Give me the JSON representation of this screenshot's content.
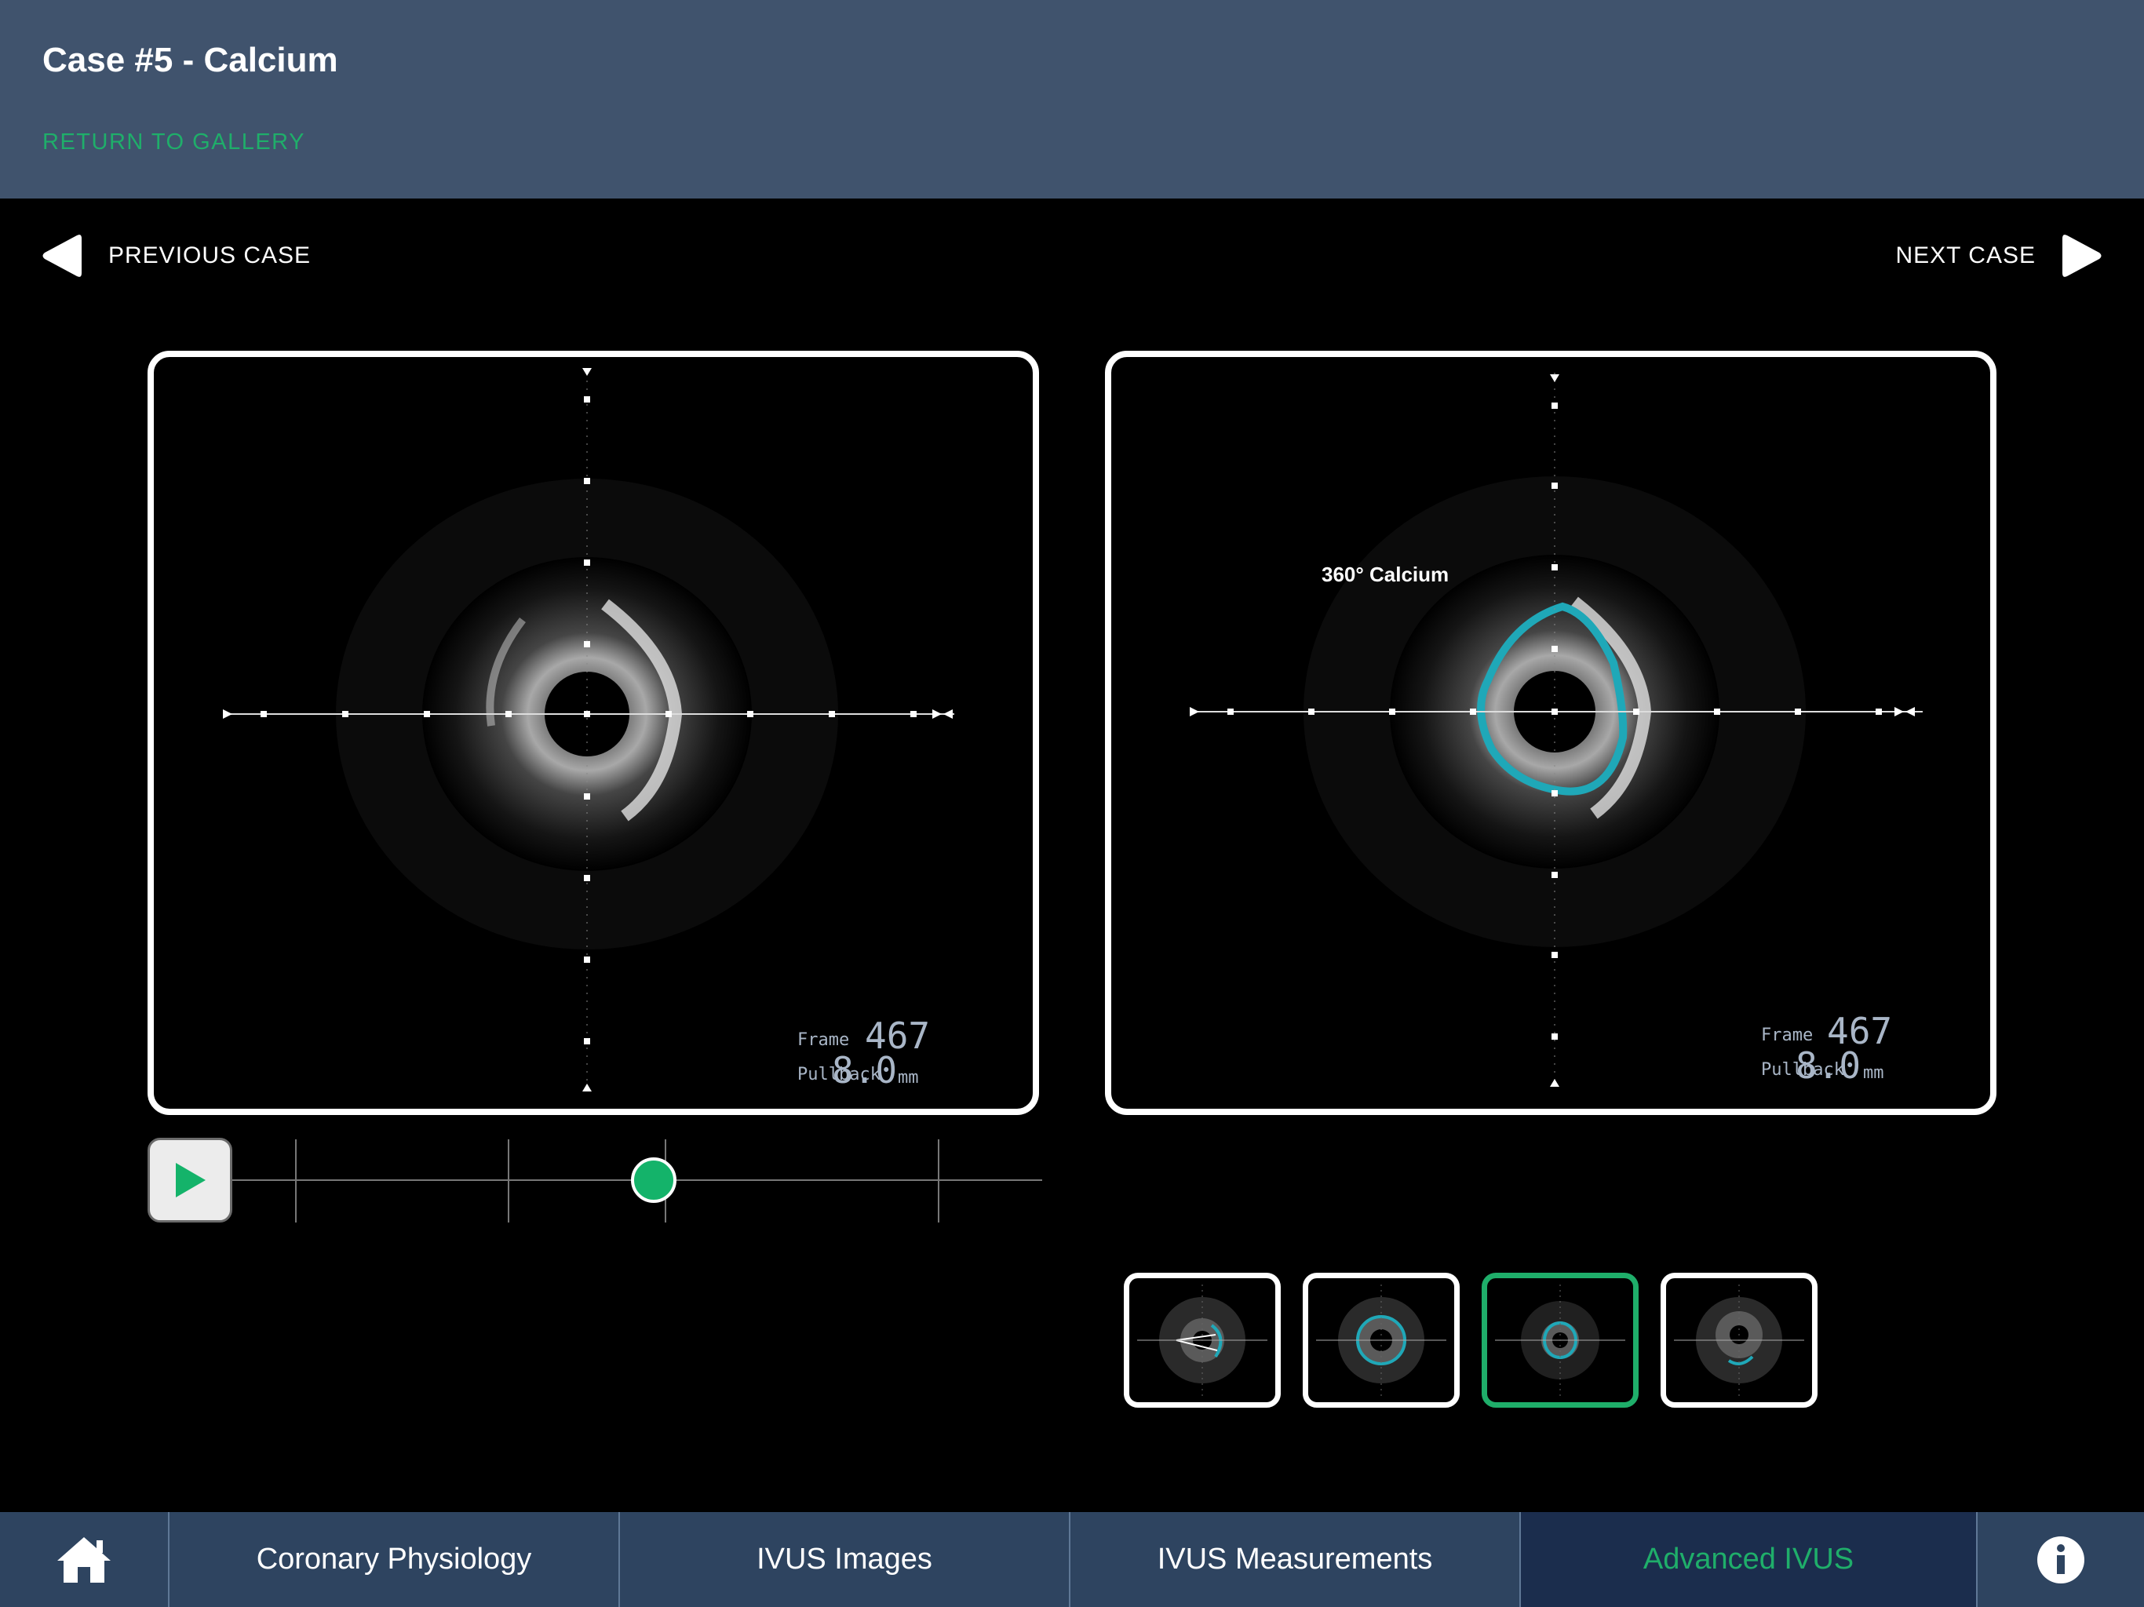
{
  "header": {
    "title": "Case #5 - Calcium",
    "return_link": "RETURN TO GALLERY"
  },
  "case_nav": {
    "previous": "PREVIOUS CASE",
    "next": "NEXT CASE"
  },
  "viewer": {
    "left": {
      "frame_label": "Frame",
      "frame": "467",
      "pullback_label": "Pullback",
      "pullback": "8.0",
      "unit": "mm"
    },
    "right": {
      "frame_label": "Frame",
      "frame": "467",
      "pullback_label": "Pullback",
      "pullback": "8.0",
      "unit": "mm",
      "annotation": "360° Calcium"
    }
  },
  "playback": {
    "position": 0.52
  },
  "thumbnails": {
    "count": 4,
    "selected_index": 2
  },
  "tabs": [
    {
      "label": "Coronary Physiology"
    },
    {
      "label": "IVUS Images"
    },
    {
      "label": "IVUS Measurements"
    },
    {
      "label": "Advanced IVUS",
      "active": true
    }
  ],
  "colors": {
    "header_bg": "#40536d",
    "accent": "#1fae6a",
    "tab_bg": "#2e4460",
    "tab_active_bg": "#1b2d4d",
    "calcium_outline": "#1fa8b8"
  }
}
